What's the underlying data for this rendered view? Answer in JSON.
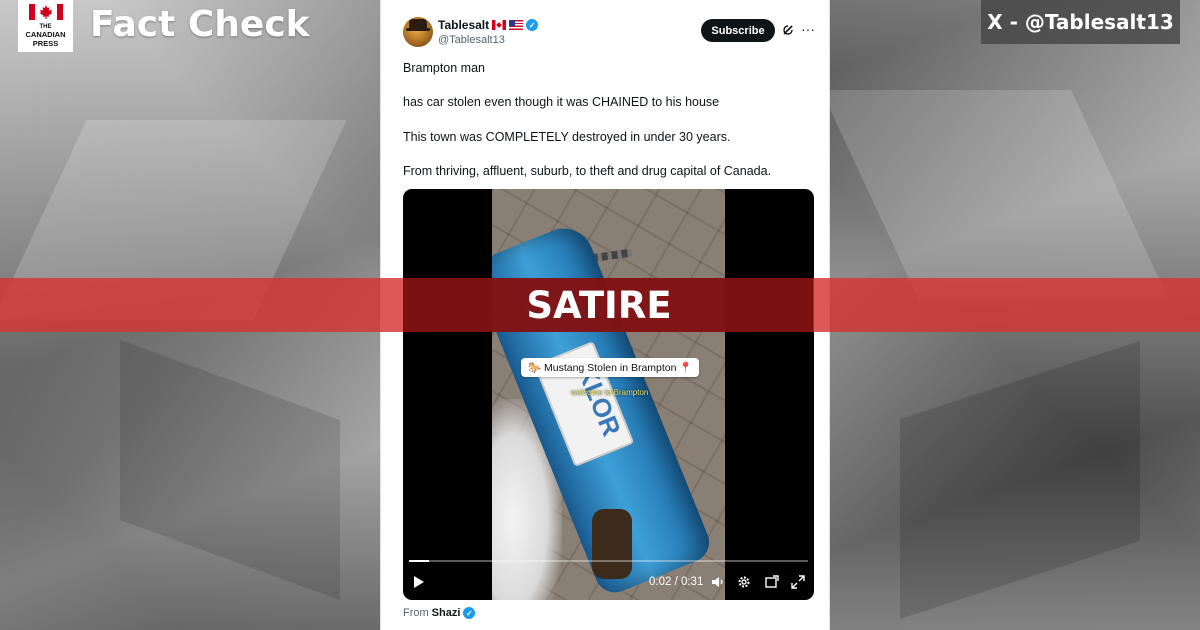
{
  "branding": {
    "logo_line1": "THE",
    "logo_line2": "CANADIAN",
    "logo_line3": "PRESS",
    "title": "Fact Check"
  },
  "source": {
    "label": "X - @Tablesalt13"
  },
  "tweet": {
    "display_name": "Tablesalt",
    "handle": "@Tablesalt13",
    "subscribe_label": "Subscribe",
    "more_label": "···",
    "lines": [
      "Brampton man",
      "has car stolen even though it was CHAINED to his house",
      "This town was COMPLETELY destroyed in under 30 years.",
      "From thriving, affluent, suburb, to theft and drug capital of Canada."
    ],
    "from_prefix": "From",
    "from_name": "Shazi"
  },
  "video": {
    "caption": "🐎 Mustang Stolen in Brampton 📍",
    "subcaption": "welcome to Brampton",
    "plate_text": "KLOR",
    "timecode": "0:02 / 0:31",
    "progress": 0.05
  },
  "banner": {
    "label": "SATIRE"
  },
  "colors": {
    "banner_red": "#d63434",
    "verified_blue": "#1d9bf0",
    "subscribe_bg": "#0f1419"
  }
}
